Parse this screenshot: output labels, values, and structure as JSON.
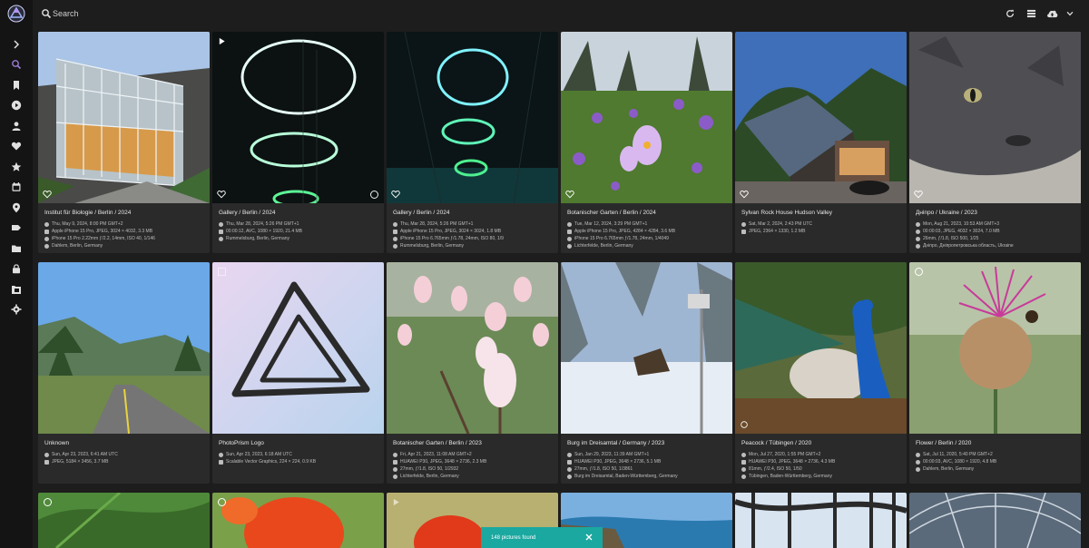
{
  "search": {
    "placeholder": "Search"
  },
  "sidebar": {
    "items": [
      {
        "icon": "chevron-right-icon"
      },
      {
        "icon": "search-icon",
        "active": true
      },
      {
        "icon": "bookmark-icon"
      },
      {
        "icon": "play-icon"
      },
      {
        "icon": "person-icon"
      },
      {
        "icon": "heart-icon"
      },
      {
        "icon": "star-icon"
      },
      {
        "icon": "calendar-icon"
      },
      {
        "icon": "location-pin-icon"
      },
      {
        "icon": "label-icon"
      },
      {
        "icon": "folder-icon"
      },
      {
        "icon": "lock-icon"
      },
      {
        "icon": "folder-library-icon"
      },
      {
        "icon": "gear-icon"
      }
    ]
  },
  "toolbar": {
    "buttons": [
      "refresh-icon",
      "view-list-icon",
      "cloud-upload-icon",
      "chevron-down-icon"
    ]
  },
  "photos": [
    {
      "title": "Institut für Biologie / Berlin / 2024",
      "date": "Thu, May 9, 2024, 8:00 PM GMT+2",
      "line2": "Apple iPhone 15 Pro, JPEG, 3024 × 4032, 3.3 MB",
      "line3": "iPhone 15 Pro 2.22mm ƒ/2.2, 14mm, ISO 40, 1/146",
      "place": "Dahlem, Berlin, Germany"
    },
    {
      "title": "Gallery / Berlin / 2024",
      "date": "Thu, Mar 28, 2024, 5:26 PM GMT+1",
      "line2": "00:00:12, AVC, 1080 × 1920, 21.4 MB",
      "line3": "",
      "place": "Rummelsburg, Berlin, Germany"
    },
    {
      "title": "Gallery / Berlin / 2024",
      "date": "Thu, Mar 28, 2024, 5:26 PM GMT+1",
      "line2": "Apple iPhone 15 Pro, JPEG, 3024 × 3024, 1.8 MB",
      "line3": "iPhone 15 Pro 6.765mm ƒ/1.78, 24mm, ISO 80, 1/9",
      "place": "Rummelsburg, Berlin, Germany"
    },
    {
      "title": "Botanischer Garten / Berlin / 2024",
      "date": "Tue, Mar 12, 2024, 3:29 PM GMT+1",
      "line2": "Apple iPhone 15 Pro, JPEG, 4284 × 4284, 3.6 MB",
      "line3": "iPhone 15 Pro 6.765mm ƒ/1.78, 24mm, 1/4049",
      "place": "Lichterfelde, Berlin, Germany"
    },
    {
      "title": "Sylvan Rock House Hudson Valley",
      "date": "Sat, Mar 2, 2024, 2:43 PM UTC",
      "line2": "JPEG, 2364 × 1330, 1.2 MB",
      "line3": "",
      "place": ""
    },
    {
      "title": "Дніпро / Ukraine / 2023",
      "date": "Mon, Aug 21, 2023, 10:53 AM GMT+3",
      "line2": "00:00:03, JPEG, 4032 × 3024, 7.0 MB",
      "line3": "26mm, ƒ/1.8, ISO 500, 1/25",
      "place": "Дніпро, Дніпропетровська область, Ukraine"
    },
    {
      "title": "Unknown",
      "date": "Sun, Apr 23, 2023, 6:41 AM UTC",
      "line2": "JPEG, 5184 × 3456, 3.7 MB",
      "line3": "",
      "place": ""
    },
    {
      "title": "PhotoPrism Logo",
      "date": "Sun, Apr 23, 2023, 6:18 AM UTC",
      "line2": "Scalable Vector Graphics, 224 × 224, 0.9 KB",
      "line3": "",
      "place": ""
    },
    {
      "title": "Botanischer Garten / Berlin / 2023",
      "date": "Fri, Apr 21, 2023, 11:08 AM GMT+2",
      "line2": "HUAWEI P30, JPEG, 3648 × 2736, 2.3 MB",
      "line3": "27mm, ƒ/1.8, ISO 50, 1/2932",
      "place": "Lichterfelde, Berlin, Germany"
    },
    {
      "title": "Burg im Dreisamtal / Germany / 2023",
      "date": "Sun, Jan 29, 2023, 11:39 AM GMT+1",
      "line2": "HUAWEI P30, JPEG, 3648 × 2736, 5.1 MB",
      "line3": "27mm, ƒ/1.8, ISO 50, 1/3861",
      "place": "Burg im Dreisamtal, Baden-Württemberg, Germany"
    },
    {
      "title": "Peacock / Tübingen / 2020",
      "date": "Mon, Jul 27, 2020, 1:55 PM GMT+2",
      "line2": "HUAWEI P30, JPEG, 3648 × 2736, 4.3 MB",
      "line3": "81mm, ƒ/2.4, ISO 50, 1/50",
      "place": "Tübingen, Baden-Württemberg, Germany"
    },
    {
      "title": "Flower / Berlin / 2020",
      "date": "Sat, Jul 11, 2020, 5:40 PM GMT+2",
      "line2": "00:00:03, AVC, 1080 × 1920, 4.8 MB",
      "line3": "",
      "place": "Dahlem, Berlin, Germany"
    }
  ],
  "snackbar": {
    "text": "148 pictures found"
  },
  "colors": {
    "accent": "#9b7bd4",
    "snackbar": "#1aa8a0",
    "card": "#2a2a2a",
    "background": "#1d1d1d"
  }
}
